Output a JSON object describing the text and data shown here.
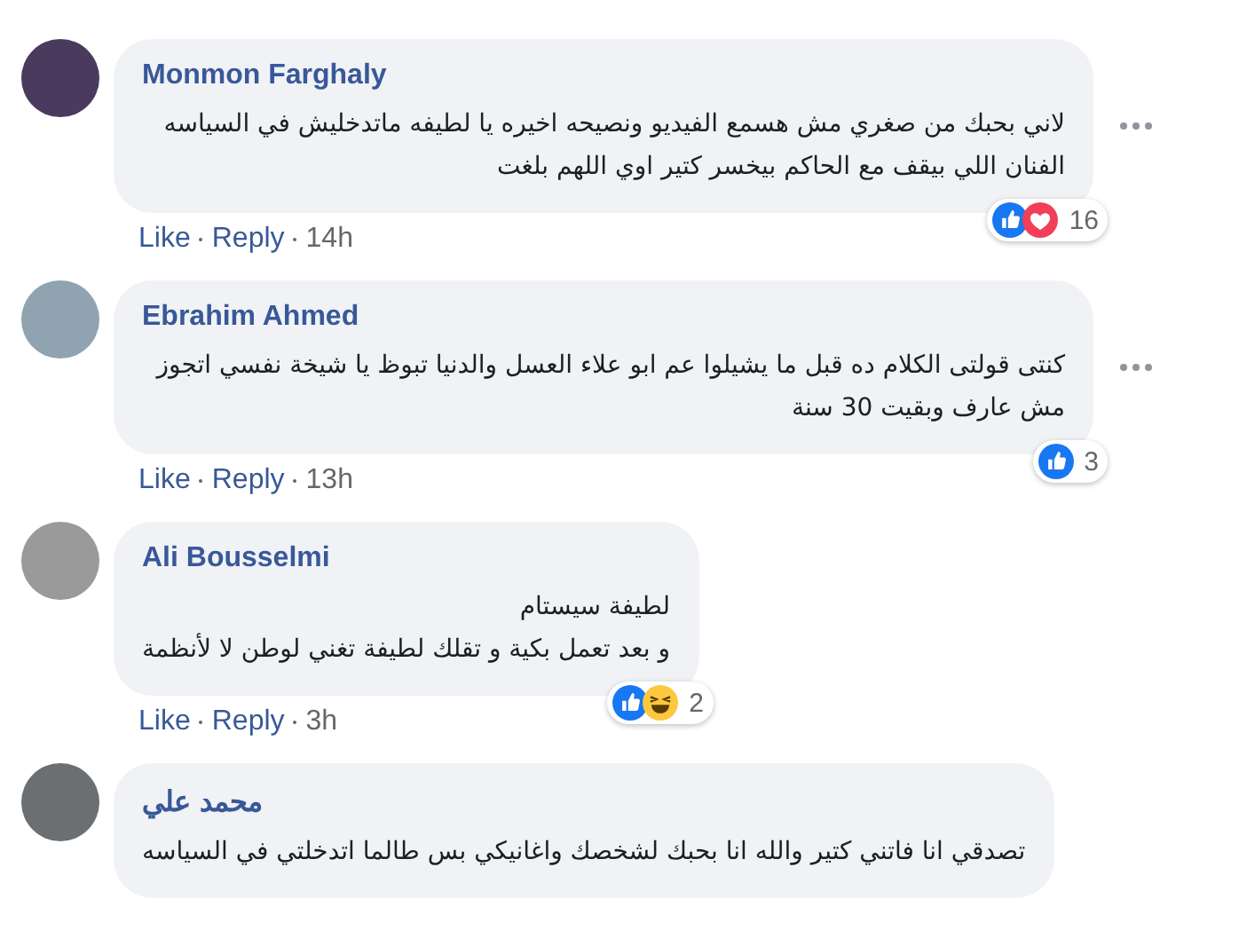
{
  "comments": [
    {
      "author": "Monmon Farghaly",
      "text": "لاني بحبك من صغري مش هسمع الفيديو ونصيحه اخيره يا لطيفه ماتدخليش في السياسه الفنان اللي بيقف مع الحاكم بيخسر كتير اوي اللهم بلغت",
      "menu_button": true,
      "reactions": [
        {
          "kind": "like"
        },
        {
          "kind": "love"
        }
      ],
      "reaction_count": "16",
      "like_label": "Like",
      "reply_label": "Reply",
      "time": "14h"
    },
    {
      "author": "Ebrahim Ahmed",
      "text": "كنتى قولتى الكلام ده قبل ما يشيلوا عم ابو علاء العسل والدنيا تبوظ يا شيخة نفسي اتجوز مش عارف وبقيت 30 سنة",
      "menu_button": true,
      "reactions": [
        {
          "kind": "like"
        }
      ],
      "reaction_count": "3",
      "like_label": "Like",
      "reply_label": "Reply",
      "time": "13h"
    },
    {
      "author": "Ali Bousselmi",
      "text": "لطيفة سيستام\nو بعد تعمل بكية و تقلك لطيفة تغني لوطن لا لأنظمة",
      "menu_button": false,
      "reactions": [
        {
          "kind": "like"
        },
        {
          "kind": "haha"
        }
      ],
      "reaction_count": "2",
      "like_label": "Like",
      "reply_label": "Reply",
      "time": "3h"
    },
    {
      "author": "محمد علي",
      "text": "تصدقي انا فاتني كتير والله انا بحبك لشخصك واغانيكي بس طالما اتدخلتي في السياسه",
      "menu_button": false
    }
  ]
}
